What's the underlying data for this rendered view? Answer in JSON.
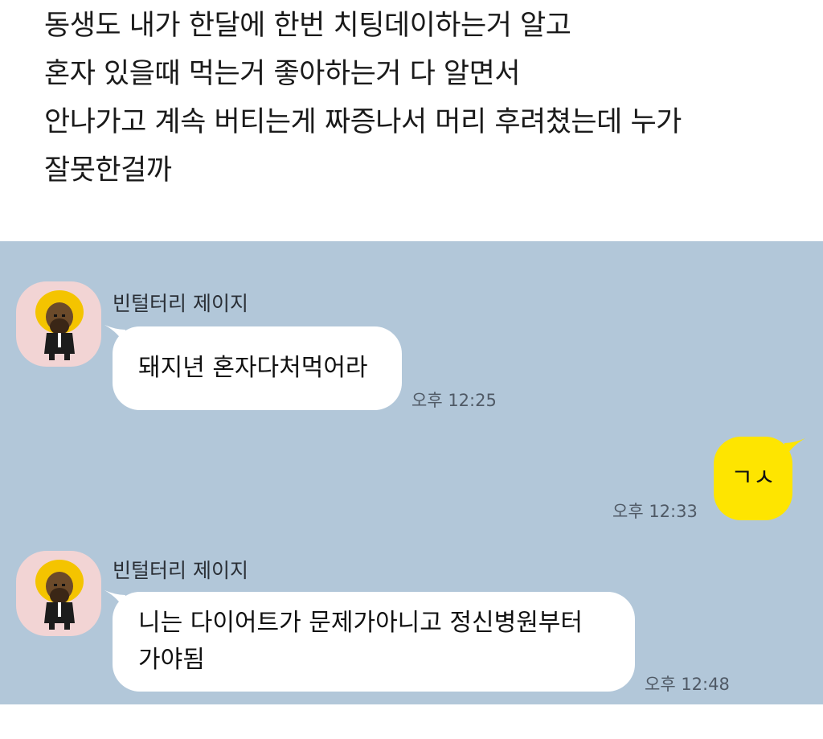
{
  "post": {
    "lines": [
      "동생도 내가 한달에 한번 치팅데이하는거 알고",
      "혼자 있을때 먹는거 좋아하는거 다 알면서",
      "안나가고 계속 버티는게 짜증나서 머리 후려쳤는데 누가",
      "잘못한걸까"
    ]
  },
  "chat": {
    "background_color": "#b2c7d9",
    "messages": [
      {
        "sender": "빈털터리 제이지",
        "lines": [
          "돼지년 혼자다처먹어라"
        ],
        "time": "오후 12:25",
        "direction": "incoming"
      },
      {
        "lines": [
          "ㄱㅅ"
        ],
        "time": "오후 12:33",
        "direction": "outgoing",
        "bubble_color": "#fee500"
      },
      {
        "sender": "빈털터리 제이지",
        "lines": [
          "니는 다이어트가 문제가아니고 정신병원부터",
          "가야됨"
        ],
        "time": "오후 12:48",
        "direction": "incoming"
      }
    ],
    "avatar_icon": "bearded-man-avatar-icon"
  }
}
